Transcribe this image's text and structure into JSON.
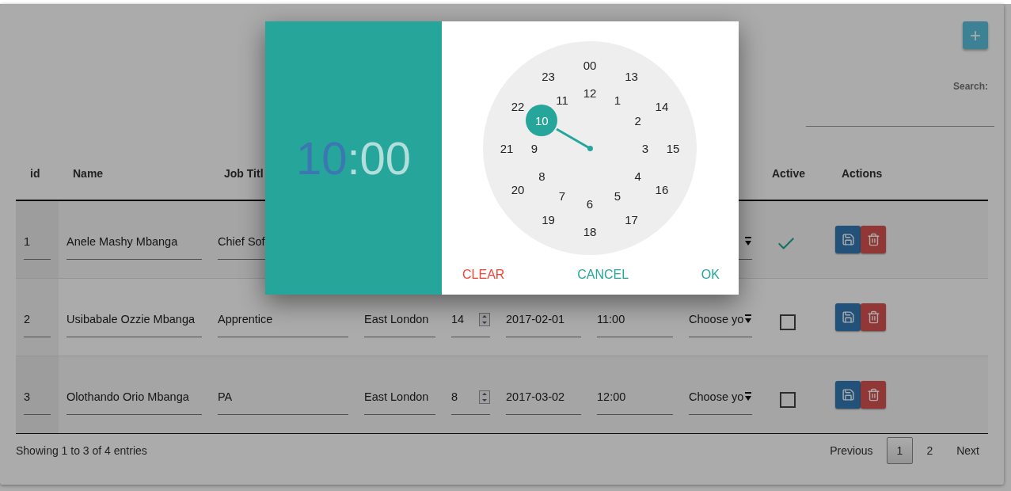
{
  "add_button": {
    "label": "+"
  },
  "search": {
    "label": "Search:"
  },
  "table": {
    "columns": [
      "id",
      "Name",
      "Job Titl",
      "Active",
      "Actions"
    ],
    "rows": [
      {
        "id": "1",
        "name": "Anele Mashy Mbanga",
        "job_title": "Chief Sof",
        "active": true
      },
      {
        "id": "2",
        "name": "Usibabale Ozzie Mbanga",
        "job_title": "Apprentice",
        "location": "East London",
        "quantity": "14",
        "date": "2017-02-01",
        "time": "11:00",
        "choice": "Choose yo",
        "active": false
      },
      {
        "id": "3",
        "name": "Olothando Orio Mbanga",
        "job_title": "PA",
        "location": "East London",
        "quantity": "8",
        "date": "2017-03-02",
        "time": "12:00",
        "choice": "Choose yo",
        "active": false
      }
    ]
  },
  "footer": {
    "info": "Showing 1 to 3 of 4 entries",
    "pagination": [
      {
        "label": "Previous",
        "selected": false
      },
      {
        "label": "1",
        "selected": true
      },
      {
        "label": "2",
        "selected": false
      },
      {
        "label": "Next",
        "selected": false
      }
    ]
  },
  "time_picker": {
    "hour": {
      "text": "10",
      "selected": true
    },
    "separator": ":",
    "minute": {
      "text": "00",
      "selected": false
    },
    "outer_ring": [
      {
        "label": "00",
        "selected": false
      },
      {
        "label": "13",
        "selected": false
      },
      {
        "label": "14",
        "selected": false
      },
      {
        "label": "15",
        "selected": false
      },
      {
        "label": "16",
        "selected": false
      },
      {
        "label": "17",
        "selected": false
      },
      {
        "label": "18",
        "selected": false
      },
      {
        "label": "19",
        "selected": false
      },
      {
        "label": "20",
        "selected": false
      },
      {
        "label": "21",
        "selected": false
      },
      {
        "label": "22",
        "selected": false
      },
      {
        "label": "23",
        "selected": false
      }
    ],
    "inner_ring": [
      {
        "label": "12",
        "selected": false
      },
      {
        "label": "1",
        "selected": false
      },
      {
        "label": "2",
        "selected": false
      },
      {
        "label": "3",
        "selected": false
      },
      {
        "label": "4",
        "selected": false
      },
      {
        "label": "5",
        "selected": false
      },
      {
        "label": "6",
        "selected": false
      },
      {
        "label": "7",
        "selected": false
      },
      {
        "label": "8",
        "selected": false
      },
      {
        "label": "9",
        "selected": false
      },
      {
        "label": "10",
        "selected": true
      },
      {
        "label": "11",
        "selected": false
      }
    ],
    "buttons": [
      {
        "label": "CLEAR",
        "kind": "danger"
      },
      {
        "label": "CANCEL",
        "kind": "normal"
      },
      {
        "label": "OK",
        "kind": "normal"
      }
    ]
  }
}
